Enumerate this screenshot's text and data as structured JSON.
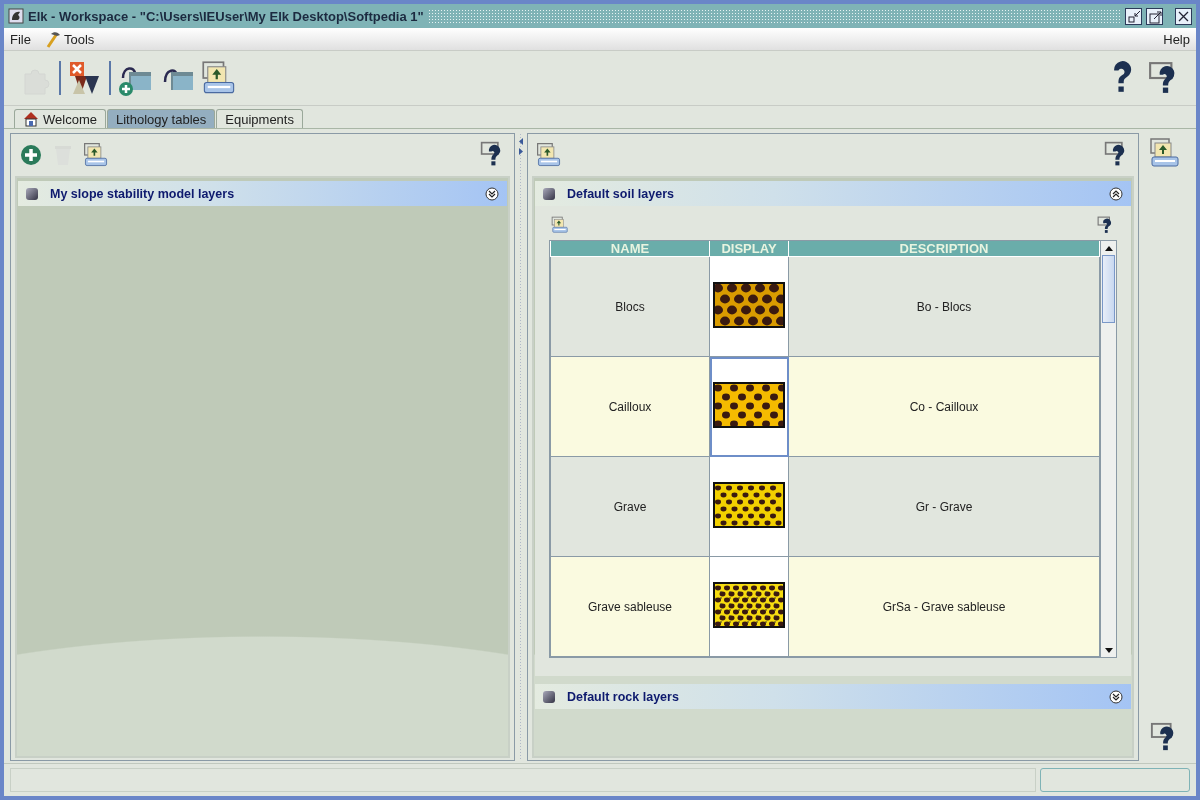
{
  "window": {
    "title": "Elk - Workspace - \"C:\\Users\\IEUser\\My Elk Desktop\\Softpedia 1\""
  },
  "menu": [
    {
      "label": "File",
      "kind": "plain"
    },
    {
      "label": "Tools",
      "kind": "tools"
    },
    {
      "label": "Help",
      "kind": "help"
    }
  ],
  "toolbar": [
    {
      "kind": "puzzle",
      "disabled": true
    },
    {
      "kind": "delete",
      "disabled": false
    },
    {
      "kind": "new-folder",
      "disabled": false
    },
    {
      "kind": "open-folder",
      "disabled": false
    },
    {
      "kind": "export",
      "disabled": false
    }
  ],
  "tabs": [
    {
      "label": "Welcome",
      "kind": "home",
      "selected": false
    },
    {
      "label": "Lithology tables",
      "kind": "plain",
      "selected": true
    },
    {
      "label": "Equipments",
      "kind": "plain",
      "selected": false
    }
  ],
  "left_panel": {
    "toolbar": [
      {
        "kind": "add",
        "disabled": false
      },
      {
        "kind": "trash",
        "disabled": true
      },
      {
        "kind": "export",
        "disabled": false
      }
    ],
    "sections": [
      {
        "title": "My slope stability model layers",
        "expanded": false
      }
    ]
  },
  "right_panel": {
    "sections": [
      {
        "title": "Default soil layers",
        "expanded": true,
        "table": {
          "columns": [
            "NAME",
            "DISPLAY",
            "DESCRIPTION"
          ],
          "rows": [
            {
              "name": "Blocs",
              "pattern": {
                "kind": "coarse",
                "color": "#d99b00"
              },
              "description": "Bo - Blocs",
              "focused": false
            },
            {
              "name": "Cailloux",
              "pattern": {
                "kind": "medium",
                "color": "#f5bb00"
              },
              "description": "Co - Cailloux",
              "focused": true
            },
            {
              "name": "Grave",
              "pattern": {
                "kind": "fine",
                "color": "#f2d000"
              },
              "description": "Gr - Grave",
              "focused": false
            },
            {
              "name": "Grave sableuse",
              "pattern": {
                "kind": "sandy",
                "color": "#f7dc10"
              },
              "description": "GrSa - Grave sableuse",
              "focused": false
            }
          ]
        }
      },
      {
        "title": "Default rock layers",
        "expanded": false
      }
    ]
  }
}
